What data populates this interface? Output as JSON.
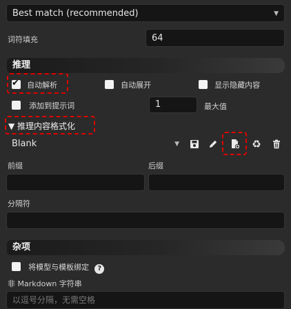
{
  "top_select": {
    "value": "Best match (recommended)"
  },
  "token_padding": {
    "label": "词符填充",
    "value": "64"
  },
  "reasoning": {
    "header": "推理",
    "auto_parse": {
      "label": "自动解析",
      "checked": true
    },
    "auto_expand": {
      "label": "自动展开",
      "checked": false
    },
    "show_hidden": {
      "label": "显示隐藏内容",
      "checked": false
    },
    "add_to_prompt": {
      "label": "添加到提示词",
      "checked": false
    },
    "max_value": "1",
    "max_label": "最大值"
  },
  "formatting": {
    "header": "▼ 推理内容格式化",
    "template_value": "Blank",
    "prefix_label": "前缀",
    "suffix_label": "后缀",
    "separator_label": "分隔符"
  },
  "misc": {
    "header": "杂项",
    "bind_model": {
      "label": "将模型与模板绑定",
      "checked": false
    },
    "help": "?",
    "non_markdown_label": "非 Markdown 字符串",
    "non_markdown_placeholder": "以逗号分隔，无需空格"
  },
  "icons": [
    "chevron-down-icon",
    "save-icon",
    "pencil-icon",
    "file-add-icon",
    "recycle-icon",
    "trash-icon"
  ]
}
